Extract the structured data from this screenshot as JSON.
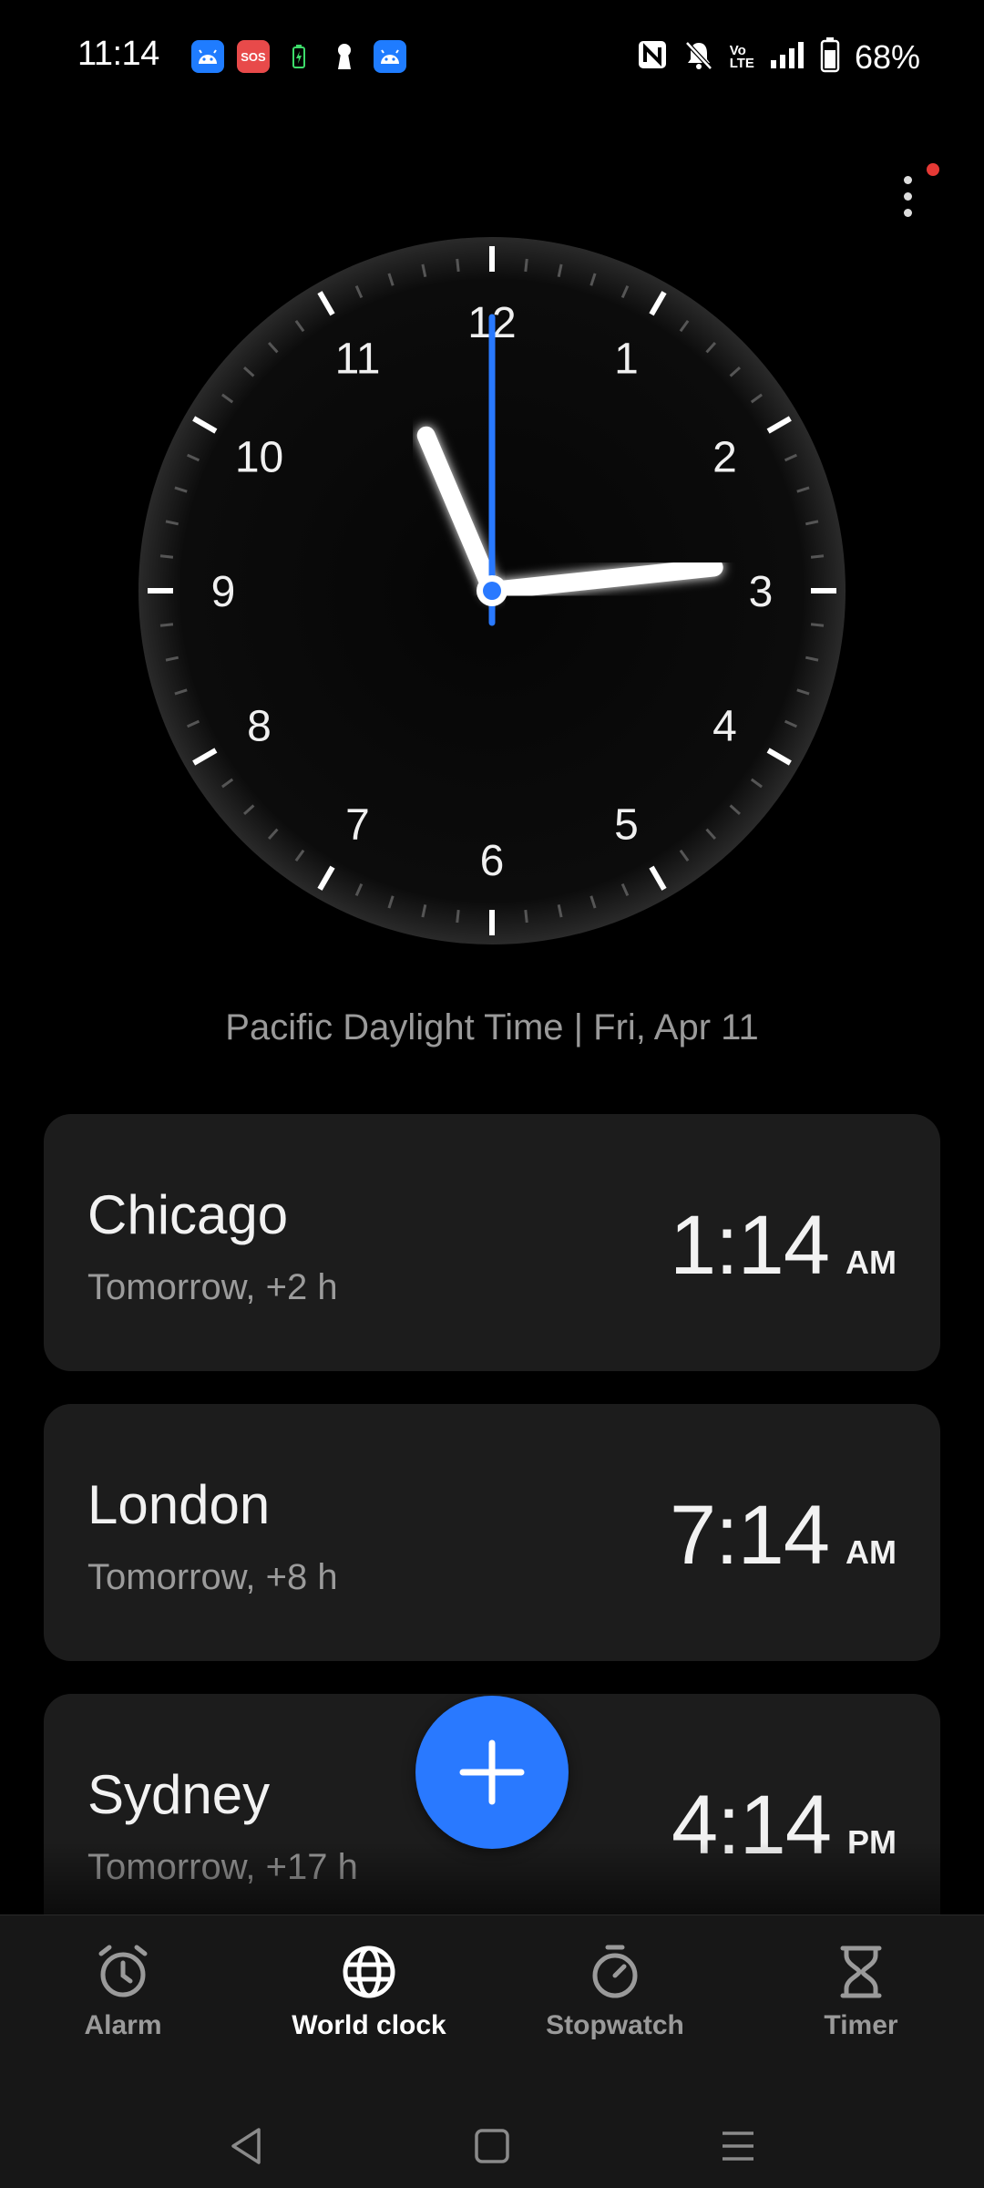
{
  "status_bar": {
    "time": "11:14",
    "battery_percent": "68%",
    "notification_icons": [
      "android-icon",
      "sos-icon",
      "battery-saver-icon",
      "keyhole-icon",
      "android-icon"
    ],
    "sos_label": "SOS",
    "system_icons": [
      "nfc-icon",
      "bell-muted-icon",
      "volte-icon",
      "signal-icon",
      "battery-icon"
    ],
    "volte_label_top": "Vo",
    "volte_label_bottom": "LTE"
  },
  "analog_clock": {
    "hour": 11,
    "minute": 14,
    "second": 0,
    "numbers": [
      "12",
      "1",
      "2",
      "3",
      "4",
      "5",
      "6",
      "7",
      "8",
      "9",
      "10",
      "11"
    ],
    "second_hand_color": "#2979ff"
  },
  "timezone_line": "Pacific Daylight Time | Fri, Apr 11",
  "cities": [
    {
      "name": "Chicago",
      "offset": "Tomorrow, +2 h",
      "time": "1:14",
      "ampm": "AM"
    },
    {
      "name": "London",
      "offset": "Tomorrow, +8 h",
      "time": "7:14",
      "ampm": "AM"
    },
    {
      "name": "Sydney",
      "offset": "Tomorrow, +17 h",
      "time": "4:14",
      "ampm": "PM"
    }
  ],
  "fab": {
    "icon": "plus-icon",
    "color": "#2979ff"
  },
  "nav": {
    "tabs": [
      {
        "label": "Alarm",
        "icon": "alarm-icon",
        "active": false
      },
      {
        "label": "World clock",
        "icon": "globe-icon",
        "active": true
      },
      {
        "label": "Stopwatch",
        "icon": "stopwatch-icon",
        "active": false
      },
      {
        "label": "Timer",
        "icon": "hourglass-icon",
        "active": false
      }
    ]
  },
  "system_nav": [
    "back-icon",
    "home-icon",
    "recents-icon"
  ]
}
